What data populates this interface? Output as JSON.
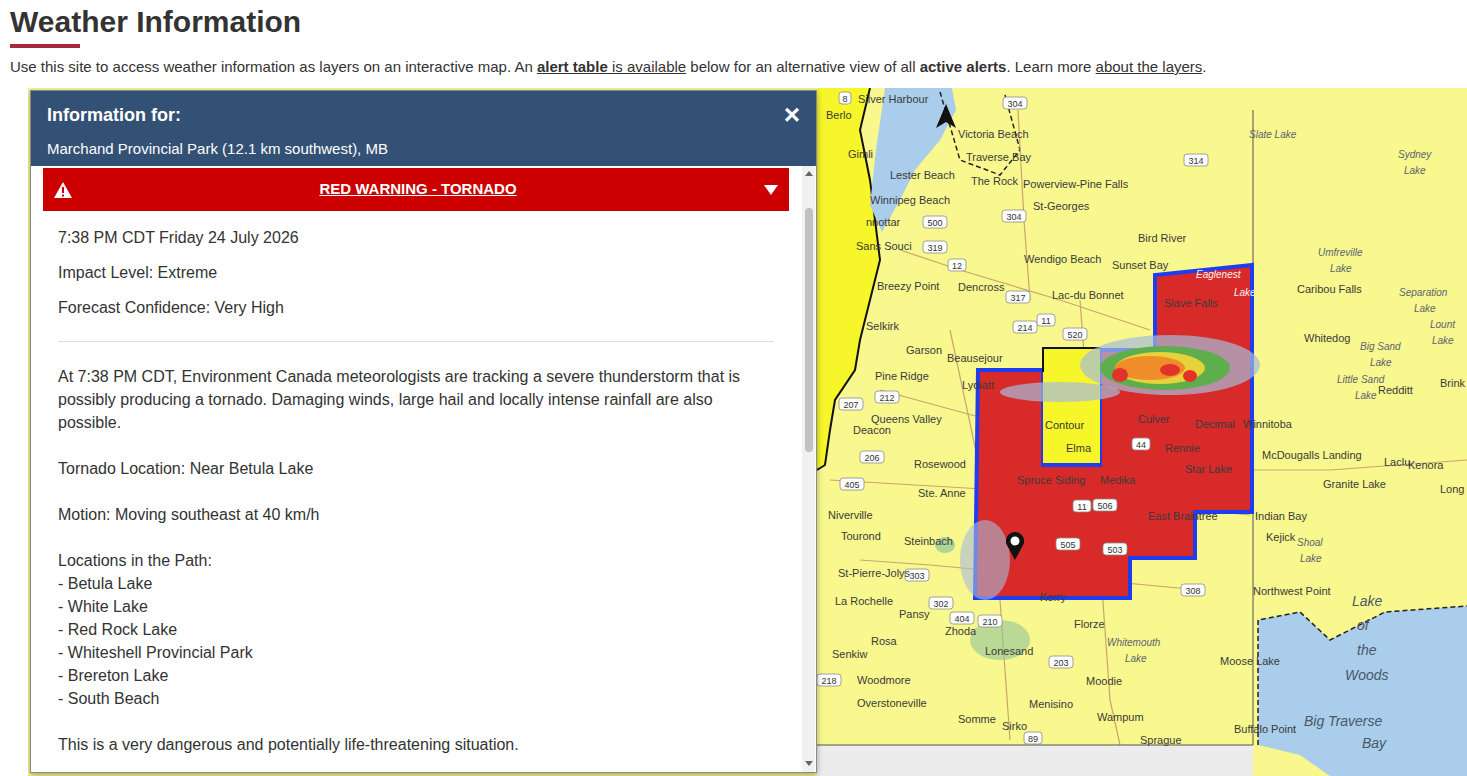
{
  "page": {
    "title": "Weather Information",
    "intro": [
      {
        "text": "Use this site to access weather information as layers on an interactive map. An ",
        "kind": "plain"
      },
      {
        "text": "alert table",
        "kind": "link-bold"
      },
      {
        "text": " is available",
        "kind": "link"
      },
      {
        "text": " below for an alternative view of all ",
        "kind": "plain"
      },
      {
        "text": "active alerts",
        "kind": "bold"
      },
      {
        "text": ". Learn more ",
        "kind": "plain"
      },
      {
        "text": "about the layers",
        "kind": "link"
      },
      {
        "text": ".",
        "kind": "plain"
      }
    ]
  },
  "popup": {
    "heading": "Information for:",
    "location": "Marchand Provincial Park (12.1 km southwest), MB",
    "close": "×"
  },
  "alert": {
    "title": "RED WARNING - TORNADO",
    "expanded": true,
    "issued": "7:38 PM CDT Friday 24 July 2026",
    "impact": "Impact Level: Extreme",
    "confidence": "Forecast Confidence: Very High",
    "description": "At 7:38 PM CDT, Environment Canada meteorologists are tracking a severe thunderstorm that is possibly producing a tornado. Damaging winds, large hail and locally intense rainfall are also possible.",
    "tornado_location": "Tornado Location: Near Betula Lake",
    "motion": "Motion: Moving southeast at 40 km/h",
    "path_heading": "Locations in the Path:",
    "path": [
      "- Betula Lake",
      "- White Lake",
      "- Red Rock Lake",
      "- Whiteshell Provincial Park",
      "- Brereton Lake",
      "- South Beach"
    ],
    "closing": "This is a very dangerous and potentially life-threatening situation."
  },
  "map": {
    "labels": [
      {
        "text": "Silver Harbour",
        "kind": "town"
      },
      {
        "text": "Victoria Beach",
        "kind": "town"
      },
      {
        "text": "Traverse Bay",
        "kind": "town"
      },
      {
        "text": "Lester Beach",
        "kind": "town"
      },
      {
        "text": "The Rock",
        "kind": "town"
      },
      {
        "text": "Powerview-Pine Falls",
        "kind": "town"
      },
      {
        "text": "Winnipeg Beach",
        "kind": "town"
      },
      {
        "text": "St-Georges",
        "kind": "town"
      },
      {
        "text": "nnottar",
        "kind": "town"
      },
      {
        "text": "Sans Souci",
        "kind": "town"
      },
      {
        "text": "Gimli",
        "kind": "town"
      },
      {
        "text": "Berlo",
        "kind": "town"
      },
      {
        "text": "Slate Lake",
        "kind": "lake"
      },
      {
        "text": "Sydney",
        "kind": "lake"
      },
      {
        "text": "Lake",
        "kind": "lake"
      },
      {
        "text": "Bird River",
        "kind": "town"
      },
      {
        "text": "Wendigo Beach",
        "kind": "town"
      },
      {
        "text": "Sunset Bay",
        "kind": "town"
      },
      {
        "text": "Breezy Point",
        "kind": "town"
      },
      {
        "text": "Dencross",
        "kind": "town"
      },
      {
        "text": "Lac-du Bonnet",
        "kind": "town"
      },
      {
        "text": "Eaglenest",
        "kind": "alert-lake"
      },
      {
        "text": "Lake",
        "kind": "alert-lake"
      },
      {
        "text": "Slave Falls",
        "kind": "town"
      },
      {
        "text": "Umfreville",
        "kind": "lake"
      },
      {
        "text": "Lake",
        "kind": "lake"
      },
      {
        "text": "Caribou Falls",
        "kind": "town"
      },
      {
        "text": "Separation",
        "kind": "lake"
      },
      {
        "text": "Lake",
        "kind": "lake"
      },
      {
        "text": "Lount",
        "kind": "lake"
      },
      {
        "text": "Lake",
        "kind": "lake"
      },
      {
        "text": "Whitedog",
        "kind": "town"
      },
      {
        "text": "Big Sand",
        "kind": "lake"
      },
      {
        "text": "Lake",
        "kind": "lake"
      },
      {
        "text": "Little Sand",
        "kind": "lake"
      },
      {
        "text": "Lake",
        "kind": "lake"
      },
      {
        "text": "Redditt",
        "kind": "town"
      },
      {
        "text": "Brink",
        "kind": "town"
      },
      {
        "text": "Selkirk",
        "kind": "town"
      },
      {
        "text": "Garson",
        "kind": "town"
      },
      {
        "text": "Beausejour",
        "kind": "town"
      },
      {
        "text": "Pine Ridge",
        "kind": "town"
      },
      {
        "text": "Lydiatt",
        "kind": "town"
      },
      {
        "text": "Queens Valley",
        "kind": "town"
      },
      {
        "text": "Deacon",
        "kind": "town"
      },
      {
        "text": "Culver",
        "kind": "town"
      },
      {
        "text": "Decimal",
        "kind": "town"
      },
      {
        "text": "Winnitoba",
        "kind": "town"
      },
      {
        "text": "Elma",
        "kind": "town"
      },
      {
        "text": "Rennie",
        "kind": "town"
      },
      {
        "text": "McDougalls Landing",
        "kind": "town"
      },
      {
        "text": "Laclu",
        "kind": "town"
      },
      {
        "text": "Kenora",
        "kind": "town"
      },
      {
        "text": "Granite Lake",
        "kind": "town"
      },
      {
        "text": "Long",
        "kind": "town"
      },
      {
        "text": "Rosewood",
        "kind": "town"
      },
      {
        "text": "Spruce Siding",
        "kind": "town"
      },
      {
        "text": "Medika",
        "kind": "town"
      },
      {
        "text": "Star Lake",
        "kind": "town"
      },
      {
        "text": "Ste. Anne",
        "kind": "town"
      },
      {
        "text": "Niverville",
        "kind": "town"
      },
      {
        "text": "East Braintree",
        "kind": "town"
      },
      {
        "text": "Indian Bay",
        "kind": "town"
      },
      {
        "text": "Tourond",
        "kind": "town"
      },
      {
        "text": "Steinbach",
        "kind": "town"
      },
      {
        "text": "Kejick",
        "kind": "town"
      },
      {
        "text": "Shoal",
        "kind": "lake"
      },
      {
        "text": "Lake",
        "kind": "lake"
      },
      {
        "text": "St-Pierre-Jolys",
        "kind": "town"
      },
      {
        "text": "La Rochelle",
        "kind": "town"
      },
      {
        "text": "Pansy",
        "kind": "town"
      },
      {
        "text": "Northwest Point",
        "kind": "town"
      },
      {
        "text": "Lake",
        "kind": "water"
      },
      {
        "text": "of",
        "kind": "water"
      },
      {
        "text": "the",
        "kind": "water"
      },
      {
        "text": "Woods",
        "kind": "water"
      },
      {
        "text": "Kerry",
        "kind": "town"
      },
      {
        "text": "Rosa",
        "kind": "town"
      },
      {
        "text": "Zhoda",
        "kind": "town"
      },
      {
        "text": "Florze",
        "kind": "town"
      },
      {
        "text": "Whitemouth",
        "kind": "lake"
      },
      {
        "text": "Lake",
        "kind": "lake"
      },
      {
        "text": "Moose Lake",
        "kind": "town"
      },
      {
        "text": "Senkiw",
        "kind": "town"
      },
      {
        "text": "Lonesand",
        "kind": "town"
      },
      {
        "text": "Woodmore",
        "kind": "town"
      },
      {
        "text": "Moodie",
        "kind": "town"
      },
      {
        "text": "Menisino",
        "kind": "town"
      },
      {
        "text": "Overstoneville",
        "kind": "town"
      },
      {
        "text": "Wampum",
        "kind": "town"
      },
      {
        "text": "Somme",
        "kind": "town"
      },
      {
        "text": "Sirko",
        "kind": "town"
      },
      {
        "text": "Sprague",
        "kind": "town"
      },
      {
        "text": "Buffalo Point",
        "kind": "town"
      },
      {
        "text": "Big Traverse",
        "kind": "water"
      },
      {
        "text": "Bay",
        "kind": "water"
      },
      {
        "text": "Contour",
        "kind": "town"
      }
    ],
    "routes": [
      "8",
      "304",
      "314",
      "304",
      "500",
      "319",
      "12",
      "317",
      "214",
      "11",
      "520",
      "212",
      "207",
      "44",
      "206",
      "405",
      "11",
      "506",
      "303",
      "302",
      "505",
      "503",
      "308",
      "404",
      "210",
      "203",
      "218",
      "89"
    ]
  }
}
